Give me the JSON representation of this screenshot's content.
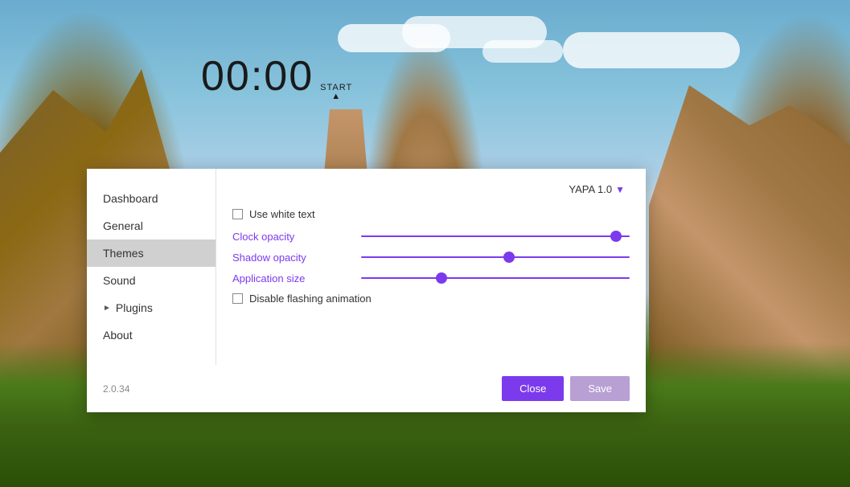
{
  "background": {
    "alt": "Mountain landscape with blue sky"
  },
  "clock": {
    "time": "00:00",
    "start_label": "START",
    "start_sub": "▲"
  },
  "dialog": {
    "sidebar": {
      "items": [
        {
          "id": "dashboard",
          "label": "Dashboard",
          "active": false,
          "has_chevron": false
        },
        {
          "id": "general",
          "label": "General",
          "active": false,
          "has_chevron": false
        },
        {
          "id": "themes",
          "label": "Themes",
          "active": true,
          "has_chevron": false
        },
        {
          "id": "sound",
          "label": "Sound",
          "active": false,
          "has_chevron": false
        },
        {
          "id": "plugins",
          "label": "Plugins",
          "active": false,
          "has_chevron": true
        },
        {
          "id": "about",
          "label": "About",
          "active": false,
          "has_chevron": false
        }
      ]
    },
    "content": {
      "theme_dropdown_label": "YAPA 1.0",
      "use_white_text_label": "Use white text",
      "clock_opacity_label": "Clock opacity",
      "shadow_opacity_label": "Shadow opacity",
      "application_size_label": "Application size",
      "disable_flashing_label": "Disable flashing animation",
      "clock_opacity_value": 95,
      "shadow_opacity_value": 55,
      "application_size_value": 30
    },
    "footer": {
      "version": "2.0.34",
      "close_label": "Close",
      "save_label": "Save"
    }
  }
}
